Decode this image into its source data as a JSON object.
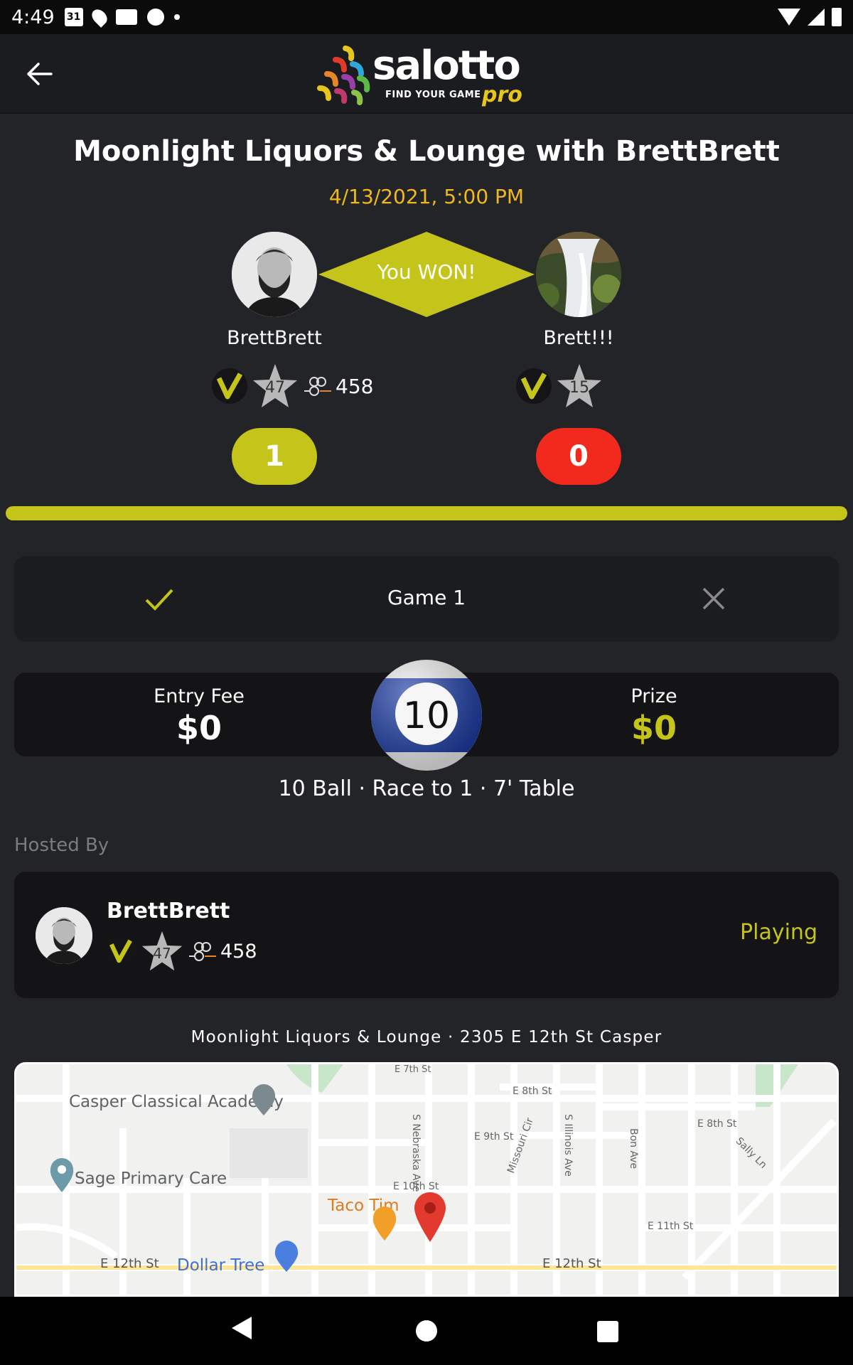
{
  "status_bar": {
    "time": "4:49",
    "calendar_day": "31"
  },
  "header": {
    "logo_word": "salotto",
    "logo_tagline": "FIND YOUR GAME",
    "logo_pro": "pro"
  },
  "match": {
    "title": "Moonlight Liquors & Lounge with BrettBrett",
    "datetime": "4/13/2021, 5:00 PM",
    "result_text": "You WON!",
    "progress_percent": 100,
    "player_left": {
      "name": "BrettBrett",
      "star_level": "47",
      "group_count": "458",
      "score": "1"
    },
    "player_right": {
      "name": "Brett!!!",
      "star_level": "15",
      "score": "0"
    }
  },
  "game": {
    "label": "Game 1"
  },
  "fees": {
    "entry_label": "Entry Fee",
    "entry_value": "$0",
    "prize_label": "Prize",
    "prize_value": "$0",
    "ball_number": "10"
  },
  "game_details": "10 Ball · Race to 1 · 7' Table",
  "host": {
    "section_label": "Hosted By",
    "name": "BrettBrett",
    "star_level": "47",
    "group_count": "458",
    "status": "Playing"
  },
  "venue": "Moonlight Liquors & Lounge · 2305 E 12th St Casper",
  "map": {
    "places": [
      "Casper Classical Academy",
      "Sage Primary Care",
      "Taco Tim",
      "Dollar Tree"
    ],
    "streets": [
      "E 7th St",
      "E 8th St",
      "E 9th St",
      "E 10th St",
      "E 11th St",
      "E 12th St",
      "S Nebraska Ave",
      "Missouri Cir",
      "S Illinois Ave",
      "Bon Ave",
      "Sally Ln",
      "E 8th St"
    ]
  },
  "colors": {
    "accent": "#c4c41a",
    "date": "#f0b81a",
    "loss": "#f2291d",
    "background": "#232428"
  }
}
